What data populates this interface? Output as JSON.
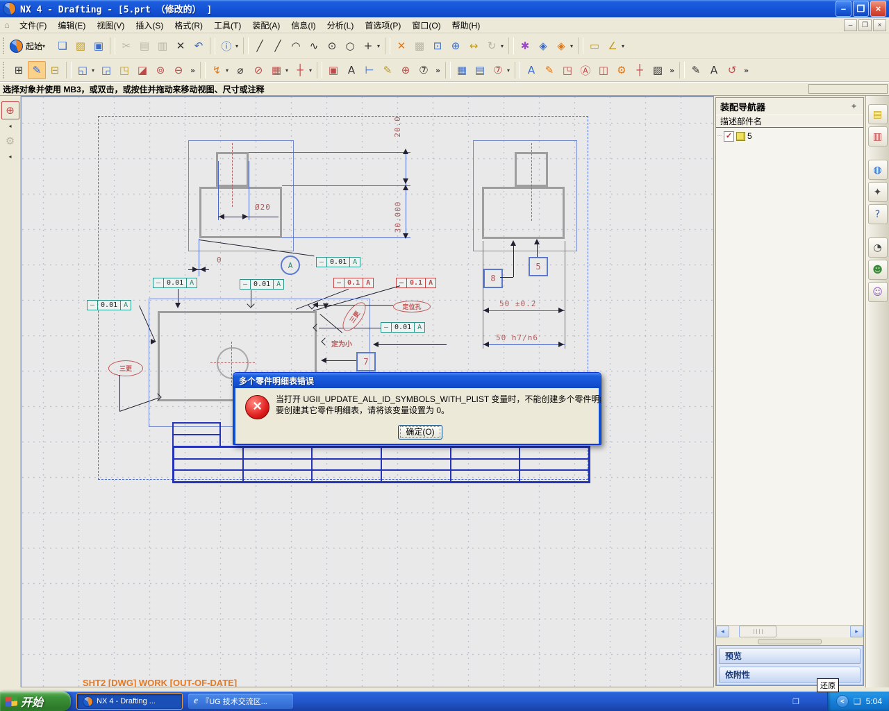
{
  "window": {
    "title": "NX 4 - Drafting - [5.prt （修改的） ]",
    "buttons": {
      "min": "–",
      "restore": "❐",
      "close": "×"
    }
  },
  "menubar": {
    "app_icon": "⌂",
    "items": [
      {
        "name": "menu-file",
        "label": "文件(F)"
      },
      {
        "name": "menu-edit",
        "label": "编辑(E)"
      },
      {
        "name": "menu-view",
        "label": "视图(V)"
      },
      {
        "name": "menu-insert",
        "label": "插入(S)"
      },
      {
        "name": "menu-format",
        "label": "格式(R)"
      },
      {
        "name": "menu-tools",
        "label": "工具(T)"
      },
      {
        "name": "menu-assemblies",
        "label": "装配(A)"
      },
      {
        "name": "menu-information",
        "label": "信息(I)"
      },
      {
        "name": "menu-analysis",
        "label": "分析(L)"
      },
      {
        "name": "menu-preferences",
        "label": "首选项(P)"
      },
      {
        "name": "menu-window",
        "label": "窗口(O)"
      },
      {
        "name": "menu-help",
        "label": "帮助(H)"
      }
    ]
  },
  "toolbar1": {
    "start_label": "起始",
    "icons": [
      {
        "name": "new-file-button",
        "glyph": "❏",
        "cls": "ic-blue"
      },
      {
        "name": "open-file-button",
        "glyph": "▨",
        "cls": "ic-yellow"
      },
      {
        "name": "save-file-button",
        "glyph": "▣",
        "cls": "ic-blue"
      },
      {
        "sep": true
      },
      {
        "name": "cut-button",
        "glyph": "✂",
        "cls": "dis"
      },
      {
        "name": "copy-button",
        "glyph": "▤",
        "cls": "dis"
      },
      {
        "name": "paste-button",
        "glyph": "▥",
        "cls": "dis"
      },
      {
        "name": "delete-button",
        "glyph": "✕",
        "cls": "ic-dark"
      },
      {
        "name": "undo-button",
        "glyph": "↶",
        "cls": "ic-blue"
      },
      {
        "sep": true
      },
      {
        "name": "information-button",
        "glyph": "ⓘ",
        "cls": "ic-blue"
      },
      {
        "name": "information-dropdown",
        "glyph": "▾",
        "cls": "dd"
      },
      {
        "sep": true
      },
      {
        "name": "profile-button",
        "glyph": "╱",
        "cls": "ic-dark"
      },
      {
        "name": "line-button",
        "glyph": "╱",
        "cls": "ic-dark"
      },
      {
        "name": "arc-button",
        "glyph": "◠",
        "cls": "ic-dark"
      },
      {
        "name": "spline-button",
        "glyph": "∿",
        "cls": "ic-dark"
      },
      {
        "name": "circle-center-button",
        "glyph": "⊙",
        "cls": "ic-dark"
      },
      {
        "name": "circle-button",
        "glyph": "○",
        "cls": "ic-dark"
      },
      {
        "name": "point-button",
        "glyph": "+",
        "cls": "ic-dark"
      },
      {
        "name": "curve-dropdown",
        "glyph": "▾",
        "cls": "dd"
      },
      {
        "sep": true
      },
      {
        "name": "fit-view-button",
        "glyph": "✕",
        "cls": "ic-orange"
      },
      {
        "name": "zoom-region-button",
        "glyph": "▩",
        "cls": "dis"
      },
      {
        "name": "zoom-window-button",
        "glyph": "⊡",
        "cls": "ic-blue"
      },
      {
        "name": "zoom-in-out-button",
        "glyph": "⊕",
        "cls": "ic-blue"
      },
      {
        "name": "pan-button",
        "glyph": "↔",
        "cls": "ic-yellow"
      },
      {
        "name": "rotate-view-button",
        "glyph": "↻",
        "cls": "dis"
      },
      {
        "name": "view-dropdown",
        "glyph": "▾",
        "cls": "dd"
      },
      {
        "sep": true
      },
      {
        "name": "visual-palette-button",
        "glyph": "✱",
        "cls": "ic-multi"
      },
      {
        "name": "update-display-button",
        "glyph": "◈",
        "cls": "ic-blue"
      },
      {
        "name": "refresh-display-button",
        "glyph": "◈",
        "cls": "ic-orange"
      },
      {
        "name": "display-dropdown",
        "glyph": "▾",
        "cls": "dd"
      },
      {
        "sep": true
      },
      {
        "name": "measure-distance-button",
        "glyph": "▭",
        "cls": "ic-yellow"
      },
      {
        "name": "measure-angle-button",
        "glyph": "∠",
        "cls": "ic-yellow"
      },
      {
        "name": "measure-dropdown",
        "glyph": "▾",
        "cls": "dd"
      }
    ]
  },
  "toolbar2": {
    "icons": [
      {
        "name": "new-sheet-button",
        "glyph": "⊞",
        "cls": "ic-dark"
      },
      {
        "name": "edit-sheet-button",
        "glyph": "✎",
        "cls": "active ic-blue"
      },
      {
        "name": "open-drawing-button",
        "glyph": "⊟",
        "cls": "ic-yellow"
      },
      {
        "sep": true
      },
      {
        "name": "base-view-button",
        "glyph": "◱",
        "cls": "ic-blue"
      },
      {
        "name": "base-view-dropdown",
        "glyph": "▾",
        "cls": "dd"
      },
      {
        "name": "projected-view-button",
        "glyph": "◲",
        "cls": "ic-blue"
      },
      {
        "name": "imported-view-button",
        "glyph": "◳",
        "cls": "ic-yellow"
      },
      {
        "name": "section-view-button",
        "glyph": "◪",
        "cls": "ic-red"
      },
      {
        "name": "detail-view-button",
        "glyph": "⊚",
        "cls": "ic-red"
      },
      {
        "name": "break-view-button",
        "glyph": "⊖",
        "cls": "ic-red"
      },
      {
        "name": "view-overflow",
        "glyph": "»",
        "cls": "ovf"
      },
      {
        "sep": true
      },
      {
        "name": "quick-dimension-button",
        "glyph": "↯",
        "cls": "ic-orange"
      },
      {
        "name": "dimension-dropdown",
        "glyph": "▾",
        "cls": "dd"
      },
      {
        "name": "cylindrical-dimension-button",
        "glyph": "⌀",
        "cls": "ic-dark"
      },
      {
        "name": "hole-dimension-button",
        "glyph": "⊘",
        "cls": "ic-red"
      },
      {
        "name": "section-line-button",
        "glyph": "▦",
        "cls": "ic-red"
      },
      {
        "name": "section-line-dropdown",
        "glyph": "▾",
        "cls": "dd"
      },
      {
        "name": "centerline-button",
        "glyph": "┼",
        "cls": "ic-red"
      },
      {
        "name": "centerline-dropdown",
        "glyph": "▾",
        "cls": "dd"
      },
      {
        "sep": true
      },
      {
        "name": "id-symbol-button",
        "glyph": "▣",
        "cls": "ic-red"
      },
      {
        "name": "note-button",
        "glyph": "A",
        "cls": "ic-dark"
      },
      {
        "name": "feature-control-frame-button",
        "glyph": "⊢",
        "cls": "ic-blue"
      },
      {
        "name": "surface-finish-button",
        "glyph": "✎",
        "cls": "ic-yellow"
      },
      {
        "name": "target-point-button",
        "glyph": "⊕",
        "cls": "ic-red"
      },
      {
        "name": "balloon-button",
        "glyph": "⑦",
        "cls": "ic-dark"
      },
      {
        "name": "annotation-overflow",
        "glyph": "»",
        "cls": "ovf"
      },
      {
        "sep": true
      },
      {
        "name": "tabular-note-button",
        "glyph": "▦",
        "cls": "ic-blue"
      },
      {
        "name": "parts-list-button",
        "glyph": "▤",
        "cls": "ic-blue"
      },
      {
        "name": "auto-balloon-button",
        "glyph": "⑦",
        "cls": "ic-red"
      },
      {
        "name": "table-dropdown",
        "glyph": "▾",
        "cls": "dd"
      },
      {
        "sep": true
      },
      {
        "name": "edit-text-button",
        "glyph": "A",
        "cls": "ic-blue"
      },
      {
        "name": "edit-appended-text-button",
        "glyph": "✎",
        "cls": "ic-orange"
      },
      {
        "name": "edit-dimension-button",
        "glyph": "◳",
        "cls": "ic-red"
      },
      {
        "name": "edit-note-button",
        "glyph": "Ⓐ",
        "cls": "ic-red"
      },
      {
        "name": "view-boundary-button",
        "glyph": "◫",
        "cls": "ic-red"
      },
      {
        "name": "edit-leader-button",
        "glyph": "⚙",
        "cls": "ic-orange"
      },
      {
        "name": "edit-origin-button",
        "glyph": "┼",
        "cls": "ic-red"
      },
      {
        "name": "edit-hatch-button",
        "glyph": "▨",
        "cls": "ic-dark"
      },
      {
        "name": "edit-overflow",
        "glyph": "»",
        "cls": "ovf"
      },
      {
        "sep": true
      },
      {
        "name": "edit-symbol-button",
        "glyph": "✎",
        "cls": "ic-dark"
      },
      {
        "name": "text-editor-button",
        "glyph": "A",
        "cls": "ic-dark"
      },
      {
        "name": "move-rotate-view-button",
        "glyph": "↺",
        "cls": "ic-red"
      },
      {
        "name": "more-overflow",
        "glyph": "»",
        "cls": "ovf"
      }
    ]
  },
  "left_toolbar": {
    "icons": [
      {
        "name": "selection-filter-button",
        "glyph": "⊕",
        "cls": "lsel"
      },
      {
        "name": "dock-collapse-arrow",
        "glyph": "◂",
        "cls": "ldd"
      },
      {
        "name": "snap-point-button",
        "glyph": "⚙",
        "cls": "dis"
      },
      {
        "name": "dock-collapse-arrow-2",
        "glyph": "◂",
        "cls": "ldd"
      }
    ]
  },
  "prompt": {
    "text": "选择对象并使用 MB3，或双击，或按住并拖动来移动视图、尺寸或注释"
  },
  "drawing": {
    "status_line": "SHT2 [DWG] WORK [OUT-OF-DATE]",
    "dim_height_top": "20.0",
    "dim_height_total": "30.000",
    "dim_diameter": "Ø20",
    "dim_zero": "0",
    "dim_width_tol": "50 ±0.2",
    "dim_width_fit": "50 h7/n6",
    "datum_label": "A",
    "fcfs": [
      {
        "symbol": "—",
        "value": "0.01",
        "datum": "A"
      },
      {
        "symbol": "—",
        "value": "0.01",
        "datum": "A"
      },
      {
        "symbol": "—",
        "value": "0.01",
        "datum": "A"
      },
      {
        "symbol": "—",
        "value": "0.1",
        "datum": "A"
      },
      {
        "symbol": "—",
        "value": "0.1",
        "datum": "A"
      },
      {
        "symbol": "—",
        "value": "0.01",
        "datum": "A"
      },
      {
        "symbol": "—",
        "value": "0.01",
        "datum": "A"
      }
    ],
    "balloon_8": "8",
    "balloon_5": "5",
    "balloon_7": "7",
    "label_oval_left": "三更",
    "label_oval_mid": "三更",
    "label_oval_right": "定位孔",
    "label_note": "定为小"
  },
  "dialog": {
    "title": "多个零件明细表错误",
    "message_line1": "当打开 UGII_UPDATE_ALL_ID_SYMBOLS_WITH_PLIST 变量时，不能创建多个零件明细表。",
    "message_line2": "要创建其它零件明细表，请将该变量设置为 0。",
    "ok_label": "确定(O)",
    "error_glyph": "×"
  },
  "navigator": {
    "title": "装配导航器",
    "pin_glyph": "+",
    "column_header": "描述部件名",
    "tree_item": {
      "label": "5",
      "check": "✓",
      "dots": "┈"
    },
    "panels": [
      {
        "label": "预览"
      },
      {
        "label": "依附性"
      }
    ],
    "scroll_left": "◂",
    "scroll_right": "▸"
  },
  "resource_bar": {
    "icons": [
      {
        "name": "assembly-navigator-icon",
        "glyph": "▤",
        "cls": "rb-y"
      },
      {
        "name": "part-navigator-icon",
        "glyph": "▥",
        "cls": "rb-r"
      },
      {
        "name": "web-browser-icon",
        "glyph": "◍",
        "cls": "rb-b gap"
      },
      {
        "name": "history-icon",
        "glyph": "✦",
        "cls": "rb-d"
      },
      {
        "name": "help-icon",
        "glyph": "?",
        "cls": "rb-b"
      },
      {
        "name": "clock-icon",
        "glyph": "◔",
        "cls": "rb-d gap"
      },
      {
        "name": "roles-icon",
        "glyph": "☻",
        "cls": "rb-g"
      },
      {
        "name": "user-icon",
        "glyph": "☺",
        "cls": "rb-p"
      }
    ]
  },
  "tooltip": {
    "text": "还原"
  },
  "taskbar": {
    "start_label": "开始",
    "tasks": [
      {
        "label": "NX 4 - Drafting ...",
        "active": true
      },
      {
        "label": "『UG 技术交流区...",
        "active": false
      }
    ],
    "tray_chevron": "<",
    "tray_icon": "❑",
    "handle_icon": "❐",
    "tray_time": "5:04"
  }
}
